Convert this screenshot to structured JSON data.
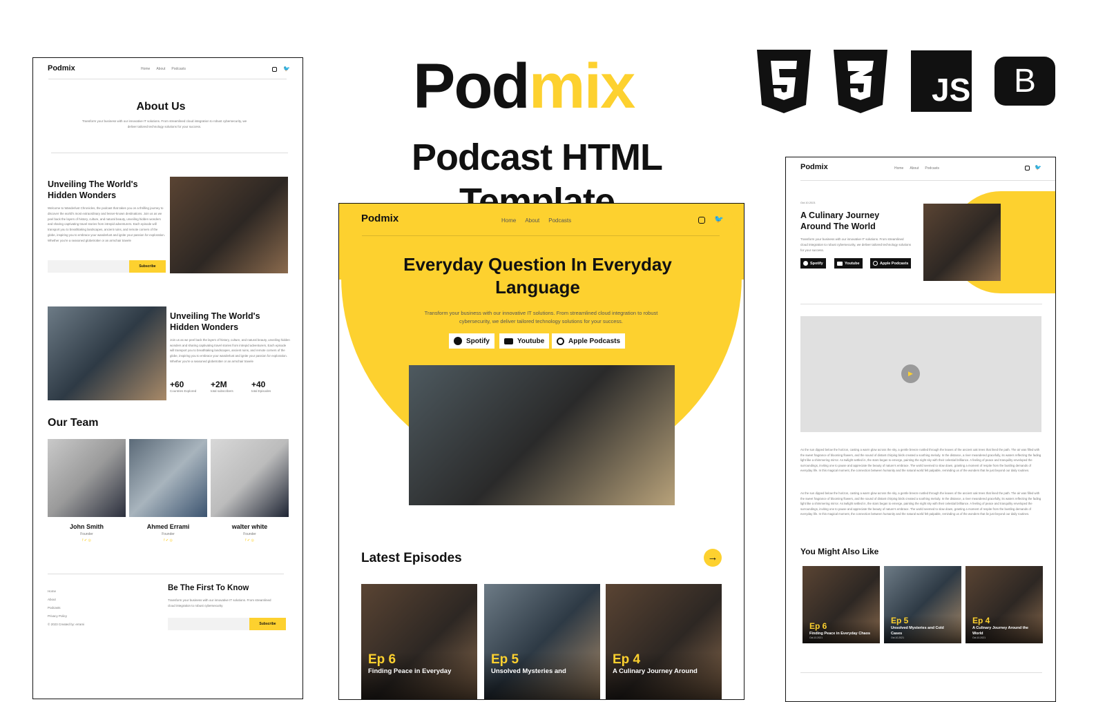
{
  "brand": {
    "pod": "Pod",
    "mix": "mix",
    "subtitle": "Podcast HTML Template",
    "accent": "#FDD12F"
  },
  "tech_icons": [
    {
      "name": "html5-icon",
      "label": "5"
    },
    {
      "name": "css3-icon",
      "label": "3"
    },
    {
      "name": "javascript-icon",
      "label": "JS"
    },
    {
      "name": "bootstrap-icon",
      "label": "B"
    }
  ],
  "nav": {
    "logo": "Podmix",
    "home": "Home",
    "about": "About",
    "podcasts": "Podcasts"
  },
  "about_page": {
    "title": "About Us",
    "desc": "Transform your business with our innovative IT solutions. From streamlined cloud integration to robust cybersecurity, we deliver tailored technology solutions for your success.",
    "s1_title": "Unveiling The World's Hidden Wonders",
    "s1_text": "Welcome to Wanderlust Chronicles, the podcast that takes you on a thrilling journey to discover the world's most extraordinary and lesser-known destinations. Join us as we peel back the layers of history, culture, and natural beauty, unveiling hidden wonders and sharing captivating travel stories from intrepid adventurers. Each episode will transport you to breathtaking landscapes, ancient ruins, and remote corners of the globe, inspiring you to embrace your wanderlust and ignite your passion for exploration. Whether you're a seasoned globetrotter or an armchair travele",
    "subscribe": "Subscribe",
    "s2_title": "Unveiling The World's Hidden Wonders",
    "s2_text": "Join us as we peel back the layers of history, culture, and natural beauty, unveiling hidden wonders and sharing captivating travel stories from intrepid adventurers, Each episode will transport you to breathtaking landscapes, ancient ruins, and remote corners of the globe, inspiring you to embrace your wanderlust and ignite your passion for exploration. Whether you're a seasoned globetrotter or an armchair travele",
    "stats": [
      {
        "value": "+60",
        "label": "Countries Explored"
      },
      {
        "value": "+2M",
        "label": "total subscribers"
      },
      {
        "value": "+40",
        "label": "total Episodes"
      }
    ],
    "team_title": "Our Team",
    "team": [
      {
        "name": "John Smith",
        "role": "Founder"
      },
      {
        "name": "Ahmed Errami",
        "role": "Founder"
      },
      {
        "name": "walter white",
        "role": "Founder"
      }
    ],
    "footer_links": [
      "Home",
      "About",
      "Podcasts",
      "Privacy Policy",
      "© 2023 Created by: errami"
    ],
    "news_title": "Be The First To Know",
    "news_desc": "Transform your business with our innovative IT solutions. From streamlined cloud integration to robust cybersecurity"
  },
  "home_page": {
    "hero_title": "Everyday Question In Everyday Language",
    "hero_desc": "Transform your business with our innovative IT solutions. From streamlined cloud integration to robust cybersecurity, we deliver tailored technology solutions for your success.",
    "platforms": [
      "Spotify",
      "Youtube",
      "Apple Podcasts"
    ],
    "latest_title": "Latest Episodes",
    "episodes": [
      {
        "num": "Ep 6",
        "title": "Finding Peace in Everyday"
      },
      {
        "num": "Ep 5",
        "title": "Unsolved Mysteries and"
      },
      {
        "num": "Ep 4",
        "title": "A Culinary Journey Around"
      }
    ]
  },
  "episode_page": {
    "date": "Oct.10.2021",
    "title": "A Culinary Journey Around The World",
    "desc": "Transform your business with our innovative IT solutions. From streamlined cloud integration to robust cybersecurity, we deliver tailored technology solutions for your success.",
    "platforms": [
      "Spotify",
      "Youtube",
      "Apple Podcasts"
    ],
    "para": "As the sun dipped below the horizon, casting a warm glow across the sky, a gentle breeze rustled through the leaves of the ancient oak trees that lined the path. The air was filled with the sweet fragrance of blooming flowers, and the sound of distant chirping birds created a soothing melody. In the distance, a river meandered gracefully, its waters reflecting the fading light like a shimmering mirror. As twilight settled in, the stars began to emerge, painting the night sky with their celestial brilliance. A feeling of peace and tranquility enveloped the surroundings, inviting one to pause and appreciate the beauty of nature's embrace. The world seemed to slow down, granting a moment of respite from the bustling demands of everyday life. In this magical moment, the connection between humanity and the natural world felt palpable, reminding us of the wonders that lie just beyond our daily routines.",
    "related_title": "You Might Also Like",
    "related": [
      {
        "num": "Ep 6",
        "title": "Finding Peace in Everyday Chaos",
        "date": "Oct.10.2021"
      },
      {
        "num": "Ep 5",
        "title": "Unsolved Mysteries and Cold Cases",
        "date": "Oct.10.2021"
      },
      {
        "num": "Ep 4",
        "title": "A Culinary Journey Around the World",
        "date": "Oct.10.2021"
      }
    ]
  }
}
